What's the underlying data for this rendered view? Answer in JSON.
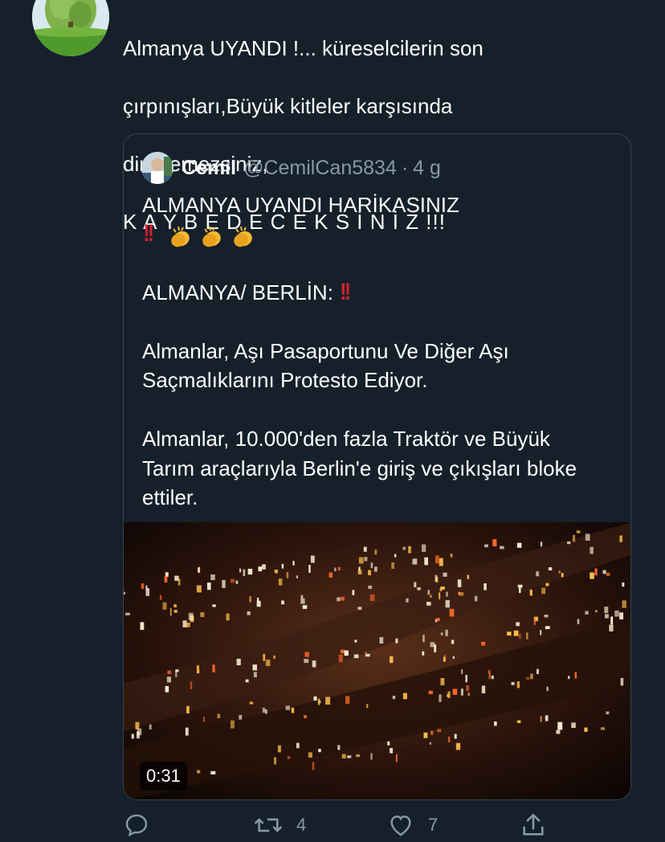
{
  "tweet": {
    "avatar_icon": "tree-avatar",
    "line1": "Almanya UYANDI !... küreselcilerin son",
    "line2": "çırpınışları,Büyük kitleler karşısında",
    "line3": "direnemezsiniz,",
    "line4": "K A Y B E D E C E K S İ N İ Z !!!"
  },
  "quote": {
    "name": "Cemil",
    "handle": "@CemilCan5834",
    "separator": "·",
    "time": "4 g",
    "line1": "ALMANYA UYANDI HARİKASINIZ",
    "line2_emoji": "‼️👏👏👏",
    "line3": "ALMANYA/ BERLİN: ",
    "line4": "Almanlar, Aşı Pasaportunu Ve Diğer Aşı",
    "line5": "Saçmalıklarını Protesto Ediyor.",
    "line6": "Almanlar, 10.000'den fazla Traktör ve Büyük",
    "line7": "Tarım araçlarıyla Berlin'e giriş ve çıkışları bloke",
    "line8": "ettiler.",
    "video": {
      "duration": "0:31"
    }
  },
  "actions": {
    "reply_count": "",
    "retweet_count": "4",
    "like_count": "7"
  },
  "colors": {
    "background": "#15202b",
    "border": "#38444d",
    "muted": "#8899a6",
    "bang": "#d6222f"
  }
}
